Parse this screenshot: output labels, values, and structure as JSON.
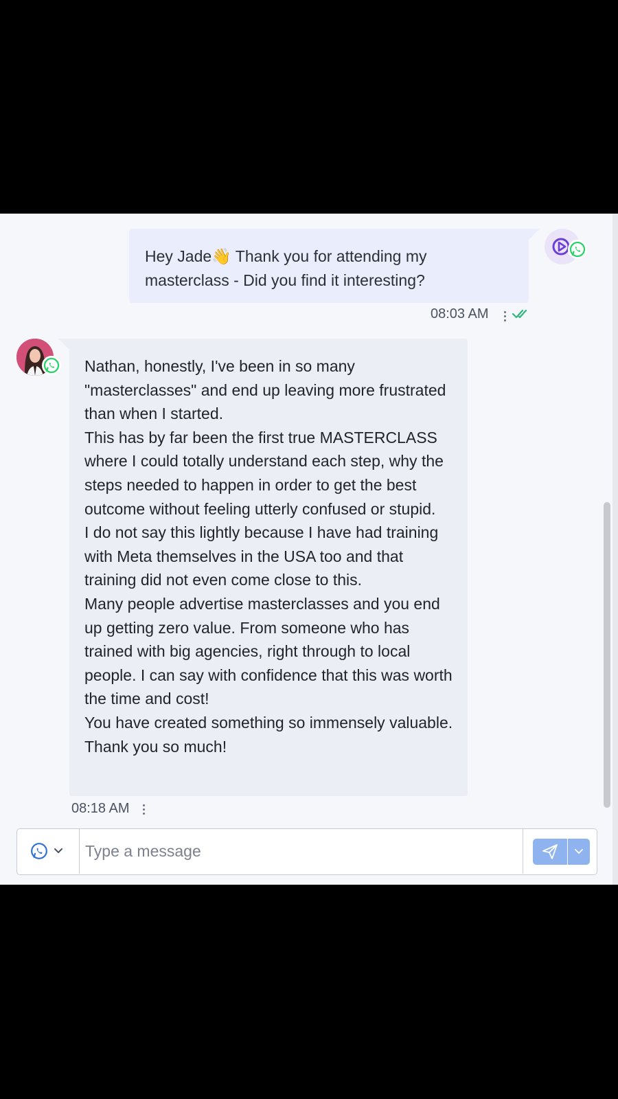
{
  "conversation": {
    "outgoing": {
      "text": "Hey Jade👋 Thank you for attending my masterclass - Did you find it interesting?",
      "time": "08:03 AM",
      "status": "read",
      "channel_icon": "whatsapp-icon",
      "avatar_icon": "play-circle-icon"
    },
    "incoming": {
      "paragraphs": [
        "Nathan, honestly, I've been in so many \"masterclasses\" and end up leaving more frustrated than when I started.",
        "This has by far been the first true MASTERCLASS where I could totally understand each step, why the steps needed to happen in order to get the best outcome without feeling utterly confused or stupid.",
        "I do not say this lightly because I have had training with Meta themselves in the USA too and that training did not even come close to this.",
        "Many people advertise masterclasses and you end up getting zero value. From someone who has trained with big agencies, right through to local people. I can say with confidence that this was worth the time and cost!",
        "You have created something so immensely valuable. Thank you so much!"
      ],
      "time": "08:18 AM",
      "channel_icon": "whatsapp-icon"
    }
  },
  "composer": {
    "channel": "whatsapp",
    "placeholder": "Type a message",
    "value": ""
  },
  "colors": {
    "panel_bg": "#f6f7fb",
    "outgoing_bubble": "#eaedfb",
    "incoming_bubble": "#ebeef4",
    "whatsapp_green": "#25d366",
    "read_ticks": "#2fb67c",
    "send_button": "#8fb3ef",
    "agent_purple": "#6b3fd6"
  }
}
